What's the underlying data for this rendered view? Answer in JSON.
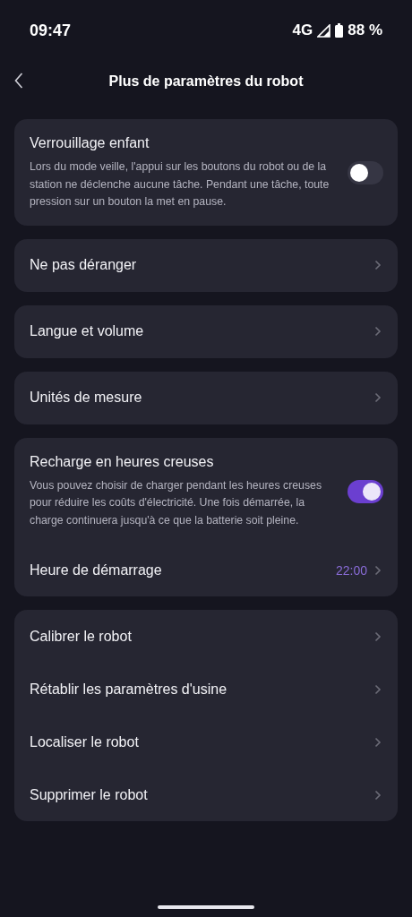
{
  "status_bar": {
    "time": "09:47",
    "network": "4G",
    "battery": "88 %"
  },
  "header": {
    "title": "Plus de paramètres du robot"
  },
  "sections": [
    {
      "kind": "toggle",
      "title": "Verrouillage enfant",
      "description": "Lors du mode veille, l'appui sur les boutons du robot ou de la station ne déclenche aucune tâche. Pendant une tâche, toute pression sur un bouton la met en pause.",
      "on": false
    },
    {
      "kind": "links",
      "items": [
        {
          "label": "Ne pas déranger"
        }
      ]
    },
    {
      "kind": "links",
      "items": [
        {
          "label": "Langue et volume"
        }
      ]
    },
    {
      "kind": "links",
      "items": [
        {
          "label": "Unités de mesure"
        }
      ]
    },
    {
      "kind": "toggle",
      "title": "Recharge en heures creuses",
      "description": "Vous pouvez choisir de charger pendant les heures creuses pour réduire les coûts d'électricité. Une fois démarrée, la charge continuera jusqu'à ce que la batterie soit pleine.",
      "on": true,
      "items": [
        {
          "label": "Heure de démarrage",
          "value": "22:00"
        }
      ]
    },
    {
      "kind": "links",
      "items": [
        {
          "label": "Calibrer le robot"
        },
        {
          "label": "Rétablir les paramètres d'usine"
        },
        {
          "label": "Localiser le robot"
        },
        {
          "label": "Supprimer le robot"
        }
      ]
    }
  ]
}
